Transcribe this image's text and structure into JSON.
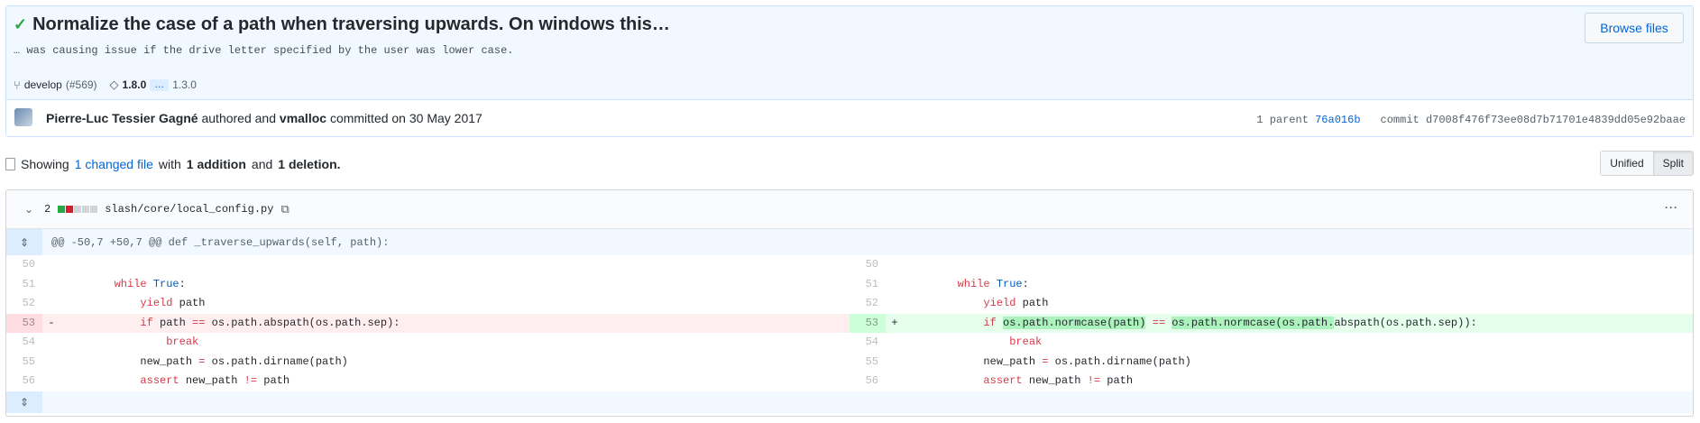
{
  "commit": {
    "title": "Normalize the case of a path when traversing upwards. On windows this…",
    "description": "… was causing issue if the drive letter specified by the user was lower case.",
    "browse_label": "Browse files",
    "branch": "develop",
    "pr": "(#569)",
    "tag_primary": "1.8.0",
    "tag_more": "…",
    "tag_last": "1.3.0",
    "author": "Pierre-Luc Tessier Gagné",
    "authored_text": "authored and",
    "committer": "vmalloc",
    "committed_text": "committed on 30 May 2017",
    "parent_label": "1 parent",
    "parent_sha": "76a016b",
    "commit_label": "commit",
    "commit_sha": "d7008f476f73ee08d7b71701e4839dd05e92baae"
  },
  "summary": {
    "showing": "Showing",
    "changed": "1 changed file",
    "with": "with",
    "additions": "1 addition",
    "and": "and",
    "deletions": "1 deletion."
  },
  "view_toggle": {
    "unified": "Unified",
    "split": "Split"
  },
  "file": {
    "count": "2",
    "path": "slash/core/local_config.py",
    "hunk_header": "@@ -50,7 +50,7 @@ def _traverse_upwards(self, path):"
  },
  "diff": {
    "left": [
      {
        "ln": "50",
        "sign": "",
        "type": "ctx",
        "code": ""
      },
      {
        "ln": "51",
        "sign": "",
        "type": "ctx",
        "code": "        while True:"
      },
      {
        "ln": "52",
        "sign": "",
        "type": "ctx",
        "code": "            yield path"
      },
      {
        "ln": "53",
        "sign": "-",
        "type": "del",
        "code": "            if path == os.path.abspath(os.path.sep):"
      },
      {
        "ln": "54",
        "sign": "",
        "type": "ctx",
        "code": "                break"
      },
      {
        "ln": "55",
        "sign": "",
        "type": "ctx",
        "code": "            new_path = os.path.dirname(path)"
      },
      {
        "ln": "56",
        "sign": "",
        "type": "ctx",
        "code": "            assert new_path != path"
      }
    ],
    "right": [
      {
        "ln": "50",
        "sign": "",
        "type": "ctx",
        "code": ""
      },
      {
        "ln": "51",
        "sign": "",
        "type": "ctx",
        "code": "        while True:"
      },
      {
        "ln": "52",
        "sign": "",
        "type": "ctx",
        "code": "            yield path"
      },
      {
        "ln": "53",
        "sign": "+",
        "type": "add",
        "code": "            if os.path.normcase(path) == os.path.normcase(os.path.abspath(os.path.sep)):"
      },
      {
        "ln": "54",
        "sign": "",
        "type": "ctx",
        "code": "                break"
      },
      {
        "ln": "55",
        "sign": "",
        "type": "ctx",
        "code": "            new_path = os.path.dirname(path)"
      },
      {
        "ln": "56",
        "sign": "",
        "type": "ctx",
        "code": "            assert new_path != path"
      }
    ]
  },
  "colors": {
    "accent": "#0366d6",
    "addition": "#28a745",
    "deletion": "#cb2431"
  },
  "icons": {
    "check": "check-icon",
    "branch": "branch-icon",
    "tag": "tag-icon",
    "chevron": "chevron-down-icon",
    "clipboard": "clipboard-icon",
    "more": "kebab-icon",
    "expand": "unfold-icon"
  }
}
